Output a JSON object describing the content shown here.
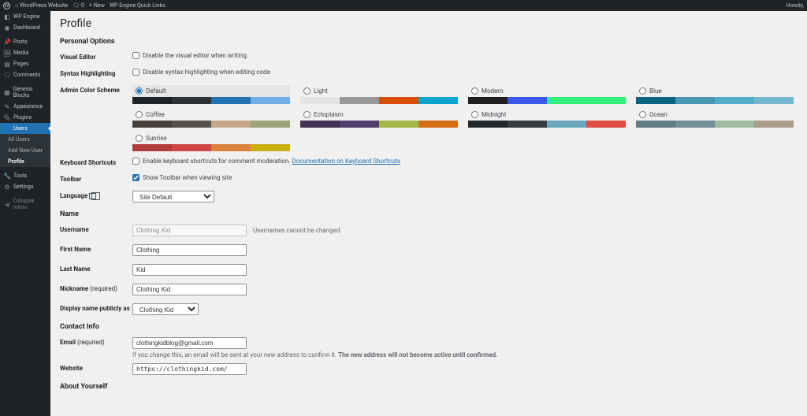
{
  "topbar": {
    "site_name": "WordPress Website",
    "comments_count": "0",
    "new_label": "New",
    "quicklinks_label": "WP Engine Quick Links",
    "howdy": "Howdy,"
  },
  "sidebar": {
    "items": [
      {
        "id": "wpengine",
        "label": "WP Engine",
        "icon": "wpengine-icon"
      },
      {
        "id": "dashboard",
        "label": "Dashboard",
        "icon": "dashboard-icon"
      },
      {
        "id": "posts",
        "label": "Posts",
        "icon": "pin-icon"
      },
      {
        "id": "media",
        "label": "Media",
        "icon": "media-icon"
      },
      {
        "id": "pages",
        "label": "Pages",
        "icon": "page-icon"
      },
      {
        "id": "comments",
        "label": "Comments",
        "icon": "comment-icon"
      },
      {
        "id": "genesis",
        "label": "Genesis Blocks",
        "icon": "blocks-icon"
      },
      {
        "id": "appearance",
        "label": "Appearance",
        "icon": "brush-icon"
      },
      {
        "id": "plugins",
        "label": "Plugins",
        "icon": "plug-icon"
      },
      {
        "id": "users",
        "label": "Users",
        "icon": "user-icon"
      },
      {
        "id": "tools",
        "label": "Tools",
        "icon": "wrench-icon"
      },
      {
        "id": "settings",
        "label": "Settings",
        "icon": "sliders-icon"
      },
      {
        "id": "collapse",
        "label": "Collapse menu",
        "icon": "collapse-icon"
      }
    ],
    "users_submenu": {
      "all_users": "All Users",
      "add_new": "Add New User",
      "profile": "Profile"
    }
  },
  "page": {
    "title": "Profile",
    "sections": {
      "personal_options": "Personal Options",
      "name": "Name",
      "contact_info": "Contact Info",
      "about_yourself": "About Yourself"
    }
  },
  "labels": {
    "visual_editor": "Visual Editor",
    "visual_editor_opt": "Disable the visual editor when writing",
    "syntax": "Syntax Highlighting",
    "syntax_opt": "Disable syntax highlighting when editing code",
    "admin_color": "Admin Color Scheme",
    "kb_shortcuts": "Keyboard Shortcuts",
    "kb_shortcuts_opt": "Enable keyboard shortcuts for comment moderation. ",
    "kb_shortcuts_link": "Documentation on Keyboard Shortcuts",
    "toolbar": "Toolbar",
    "toolbar_opt": "Show Toolbar when viewing site",
    "language": "Language",
    "language_value": "Site Default",
    "username_label": "Username",
    "username_note": "Usernames cannot be changed.",
    "first_name": "First Name",
    "last_name": "Last Name",
    "nickname": "Nickname",
    "display_name": "Display name publicly as",
    "email_label": "Email",
    "required": "(required)",
    "email_hint": "If you change this, an email will be sent at your new address to confirm it. ",
    "email_hint_bold": "The new address will not become active until confirmed.",
    "website": "Website"
  },
  "values": {
    "username": "Clothing Kid",
    "first_name": "Clothing",
    "last_name": "Kid",
    "nickname": "Clothing Kid",
    "display_name": "Clothing Kid",
    "email": "clothingkidblog@gmail.com",
    "website": "https://clothingkid.com/"
  },
  "color_schemes": [
    {
      "name": "Default",
      "selected": true,
      "colors": [
        "#1d2327",
        "#2c3338",
        "#2271b1",
        "#72aee6"
      ]
    },
    {
      "name": "Light",
      "selected": false,
      "colors": [
        "#e5e5e5",
        "#999999",
        "#d64e07",
        "#04a4cc"
      ]
    },
    {
      "name": "Modern",
      "selected": false,
      "colors": [
        "#1e1e1e",
        "#3858e9",
        "#33f078",
        "#33f078"
      ]
    },
    {
      "name": "Blue",
      "selected": false,
      "colors": [
        "#096484",
        "#4796b3",
        "#52accc",
        "#74b6ce"
      ]
    },
    {
      "name": "Coffee",
      "selected": false,
      "colors": [
        "#46403c",
        "#59524c",
        "#c7a589",
        "#9ea476"
      ]
    },
    {
      "name": "Ectoplasm",
      "selected": false,
      "colors": [
        "#413256",
        "#523f6d",
        "#a3b745",
        "#d46f15"
      ]
    },
    {
      "name": "Midnight",
      "selected": false,
      "colors": [
        "#25282b",
        "#363b3f",
        "#69a8bb",
        "#e14d43"
      ]
    },
    {
      "name": "Ocean",
      "selected": false,
      "colors": [
        "#627c83",
        "#738e96",
        "#9ebaa0",
        "#aa9d88"
      ]
    },
    {
      "name": "Sunrise",
      "selected": false,
      "colors": [
        "#b43c38",
        "#cf4944",
        "#dd823b",
        "#ccaf0b"
      ]
    }
  ]
}
